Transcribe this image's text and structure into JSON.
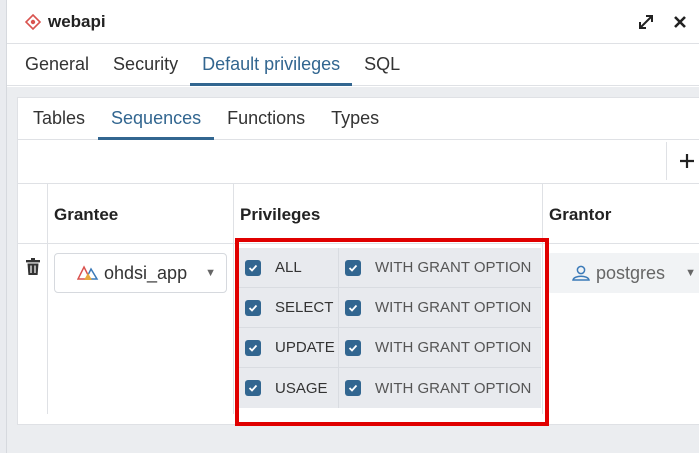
{
  "window": {
    "title": "webapi",
    "title_icon": "role-diamond-icon",
    "actions": [
      "maximize-icon",
      "close-icon"
    ]
  },
  "main_tabs": [
    {
      "label": "General"
    },
    {
      "label": "Security"
    },
    {
      "label": "Default privileges",
      "active": true
    },
    {
      "label": "SQL"
    }
  ],
  "sub_tabs": [
    {
      "label": "Tables"
    },
    {
      "label": "Sequences",
      "active": true
    },
    {
      "label": "Functions"
    },
    {
      "label": "Types"
    }
  ],
  "toolbar": {
    "add_label": "+"
  },
  "grid": {
    "headers": {
      "grantee": "Grantee",
      "privileges": "Privileges",
      "grantor": "Grantor"
    },
    "row": {
      "grantee": "ohdsi_app",
      "grantor": "postgres",
      "privileges": [
        {
          "name": "ALL",
          "checked": true,
          "grant_label": "WITH GRANT OPTION",
          "grant_checked": true
        },
        {
          "name": "SELECT",
          "checked": true,
          "grant_label": "WITH GRANT OPTION",
          "grant_checked": true
        },
        {
          "name": "UPDATE",
          "checked": true,
          "grant_label": "WITH GRANT OPTION",
          "grant_checked": true
        },
        {
          "name": "USAGE",
          "checked": true,
          "grant_label": "WITH GRANT OPTION",
          "grant_checked": true
        }
      ]
    }
  },
  "colors": {
    "accent": "#326690",
    "highlight": "#e00000"
  }
}
